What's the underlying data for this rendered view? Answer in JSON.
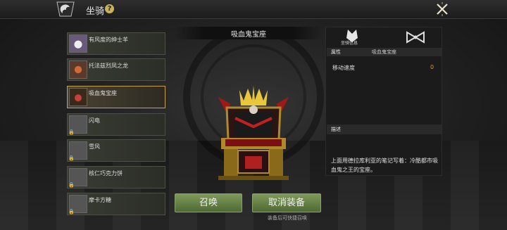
{
  "header": {
    "title": "坐骑",
    "help": "?"
  },
  "mounts": [
    {
      "name": "有风度的绅士羊",
      "locked": false
    },
    {
      "name": "托法兹烈凤之龙",
      "locked": false
    },
    {
      "name": "吸血鬼宝座",
      "locked": false,
      "selected": true
    },
    {
      "name": "闪电",
      "locked": true
    },
    {
      "name": "雪风",
      "locked": true
    },
    {
      "name": "核仁巧克力饼",
      "locked": true
    },
    {
      "name": "摩卡方糖",
      "locked": true
    }
  ],
  "preview": {
    "name": "吸血鬼宝座"
  },
  "actions": {
    "summon": "召唤",
    "unequip": "取消装备",
    "hint": "装备后可快捷召唤"
  },
  "info": {
    "tab_label": "坐骑信息",
    "attr_header": "属性",
    "attr_mount": "吸血鬼宝座",
    "stat_label": "移动速度",
    "stat_value": "0",
    "desc_header": "描述",
    "description": "上面用德拉库利亚的笔记写着：冷酷都市吸血鬼之王的宝座。"
  },
  "colors": {
    "accent": "#c8a24a",
    "button": "#6b8a48",
    "stat": "#d39a3a"
  }
}
